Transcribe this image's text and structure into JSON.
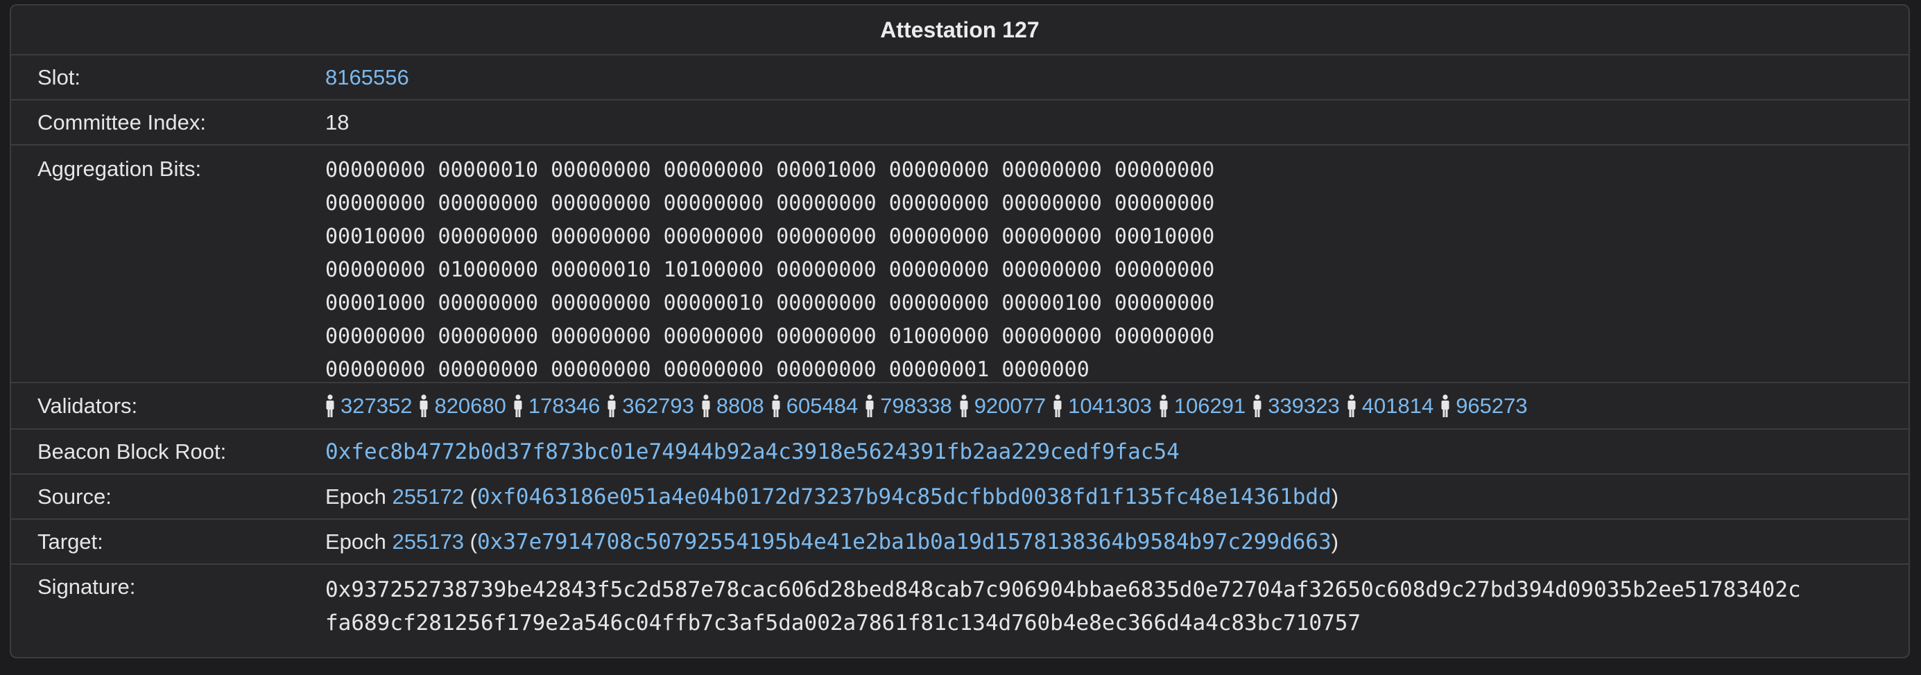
{
  "title": "Attestation 127",
  "slot": {
    "label": "Slot:",
    "value": "8165556"
  },
  "committee_index": {
    "label": "Committee Index:",
    "value": "18"
  },
  "aggregation_bits": {
    "label": "Aggregation Bits:",
    "lines": [
      "00000000 00000010 00000000 00000000 00001000 00000000 00000000 00000000",
      "00000000 00000000 00000000 00000000 00000000 00000000 00000000 00000000",
      "00010000 00000000 00000000 00000000 00000000 00000000 00000000 00010000",
      "00000000 01000000 00000010 10100000 00000000 00000000 00000000 00000000",
      "00001000 00000000 00000000 00000010 00000000 00000000 00000100 00000000",
      "00000000 00000000 00000000 00000000 00000000 01000000 00000000 00000000",
      "00000000 00000000 00000000 00000000 00000000 00000001 0000000"
    ]
  },
  "validators": {
    "label": "Validators:",
    "icon": "person-icon",
    "items": [
      "327352",
      "820680",
      "178346",
      "362793",
      "8808",
      "605484",
      "798338",
      "920077",
      "1041303",
      "106291",
      "339323",
      "401814",
      "965273"
    ]
  },
  "beacon_block_root": {
    "label": "Beacon Block Root:",
    "value": "0xfec8b4772b0d37f873bc01e74944b92a4c3918e5624391fb2aa229cedf9fac54"
  },
  "source": {
    "label": "Source:",
    "epoch_word": "Epoch",
    "epoch": "255172",
    "open": "(",
    "root": "0xf0463186e051a4e04b0172d73237b94c85dcfbbd0038fd1f135fc48e14361bdd",
    "close": ")"
  },
  "target": {
    "label": "Target:",
    "epoch_word": "Epoch",
    "epoch": "255173",
    "open": "(",
    "root": "0x37e7914708c50792554195b4e41e2ba1b0a19d1578138364b9584b97c299d663",
    "close": ")"
  },
  "signature": {
    "label": "Signature:",
    "lines": [
      "0x937252738739be42843f5c2d587e78cac606d28bed848cab7c906904bbae6835d0e72704af32650c608d9c27bd394d09035b2ee51783402c",
      "fa689cf281256f179e2a546c04ffb7c3af5da002a7861f81c134d760b4e8ec366d4a4c83bc710757"
    ]
  },
  "colors": {
    "link": "#7cb9ee",
    "background": "#1c1c1e",
    "panel": "#252527",
    "border": "#3c3c3f"
  }
}
